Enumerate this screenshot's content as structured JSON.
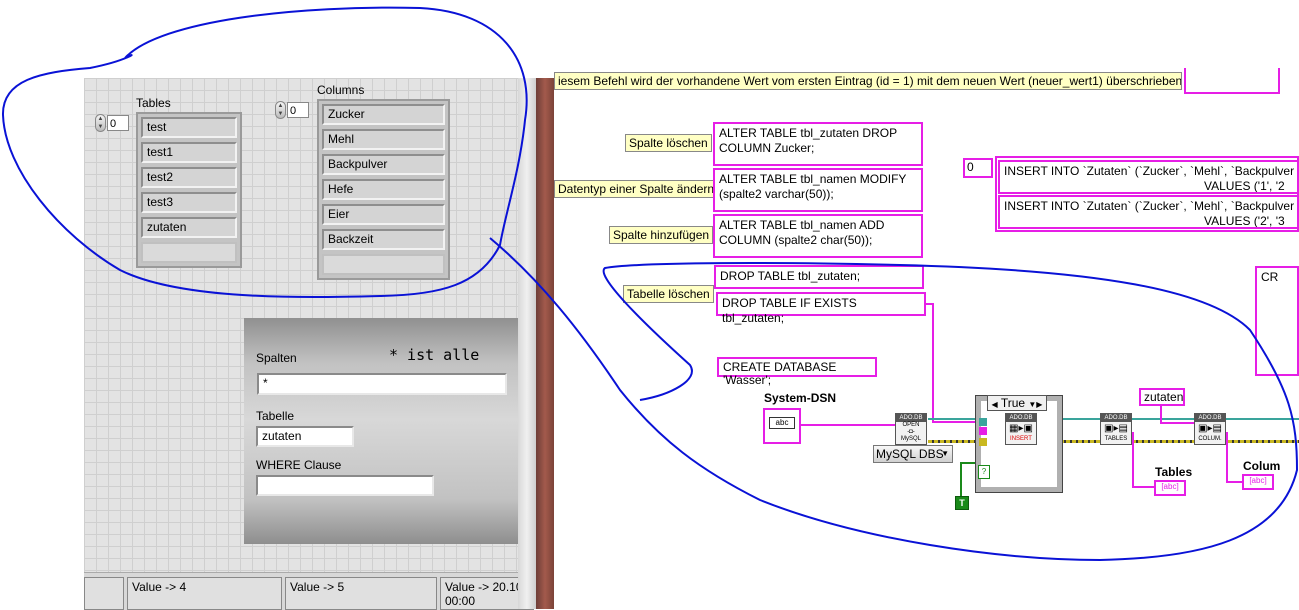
{
  "front_panel": {
    "tables": {
      "label": "Tables",
      "index": "0",
      "items": [
        "test",
        "test1",
        "test2",
        "test3",
        "zutaten"
      ]
    },
    "columns": {
      "label": "Columns",
      "index": "0",
      "items": [
        "Zucker",
        "Mehl",
        "Backpulver",
        "Hefe",
        "Eier",
        "Backzeit"
      ]
    },
    "query": {
      "spalten_label": "Spalten",
      "hint": "* ist alle",
      "spalten_value": "*",
      "tabelle_label": "Tabelle",
      "tabelle_value": "zutaten",
      "where_label": "WHERE Clause",
      "where_value": ""
    },
    "statusbar": [
      "Value -> 4",
      "Value -> 5",
      "Value -> 20.10\n00:00"
    ]
  },
  "block_diagram": {
    "top_comment": "iesem Befehl wird der vorhandene Wert vom ersten Eintrag (id = 1) mit dem neuen Wert (neuer_wert1) überschrieben.",
    "notes": {
      "spalte_loeschen": "Spalte löschen",
      "datentyp": "Datentyp einer Spalte ändern",
      "spalte_hinzufuegen": "Spalte hinzufügen",
      "tabelle_loeschen": "Tabelle löschen"
    },
    "sql": {
      "drop_column": "ALTER TABLE tbl_zutaten DROP COLUMN Zucker;",
      "modify": "ALTER TABLE tbl_namen MODIFY (spalte2 varchar(50));",
      "add_column": "ALTER TABLE tbl_namen ADD COLUMN (spalte2 char(50));",
      "drop_table": "DROP TABLE tbl_zutaten;",
      "drop_if_exists": "DROP TABLE IF EXISTS tbl_zutaten;",
      "create_db": "CREATE DATABASE 'Wasser';",
      "insert1": "INSERT INTO `Zutaten` (`Zucker`, `Mehl`, `Backpulver",
      "insert1b": "VALUES ('1', '2",
      "insert2": "INSERT INTO `Zutaten` (`Zucker`, `Mehl`, `Backpulver",
      "insert2b": "VALUES ('2', '3",
      "array_index": "0",
      "cr": "CR"
    },
    "system_dsn_label": "System-DSN",
    "dsn_ctrl": "abc",
    "case_selector": "True",
    "mysql_ring": "MySQL DBS",
    "zutaten_const": "zutaten",
    "tables_label": "Tables",
    "columns_label": "Colum",
    "true_const": "T",
    "ado_open": {
      "hdr": "ADO.DB",
      "line1": "OPEN",
      "line2": "MySQL"
    },
    "ado_insert": {
      "hdr": "ADO.DB",
      "line1": "INSERT"
    },
    "ado_tables": {
      "hdr": "ADO.DB",
      "line1": "TABLES"
    },
    "ado_colum": {
      "hdr": "ADO.DB",
      "line1": "COLUM."
    }
  },
  "colors": {
    "string_wire": "#e61ee6",
    "refnum_wire": "#3aa49c",
    "error_wire": "#c9b820",
    "annotation": "#0a12d6"
  }
}
